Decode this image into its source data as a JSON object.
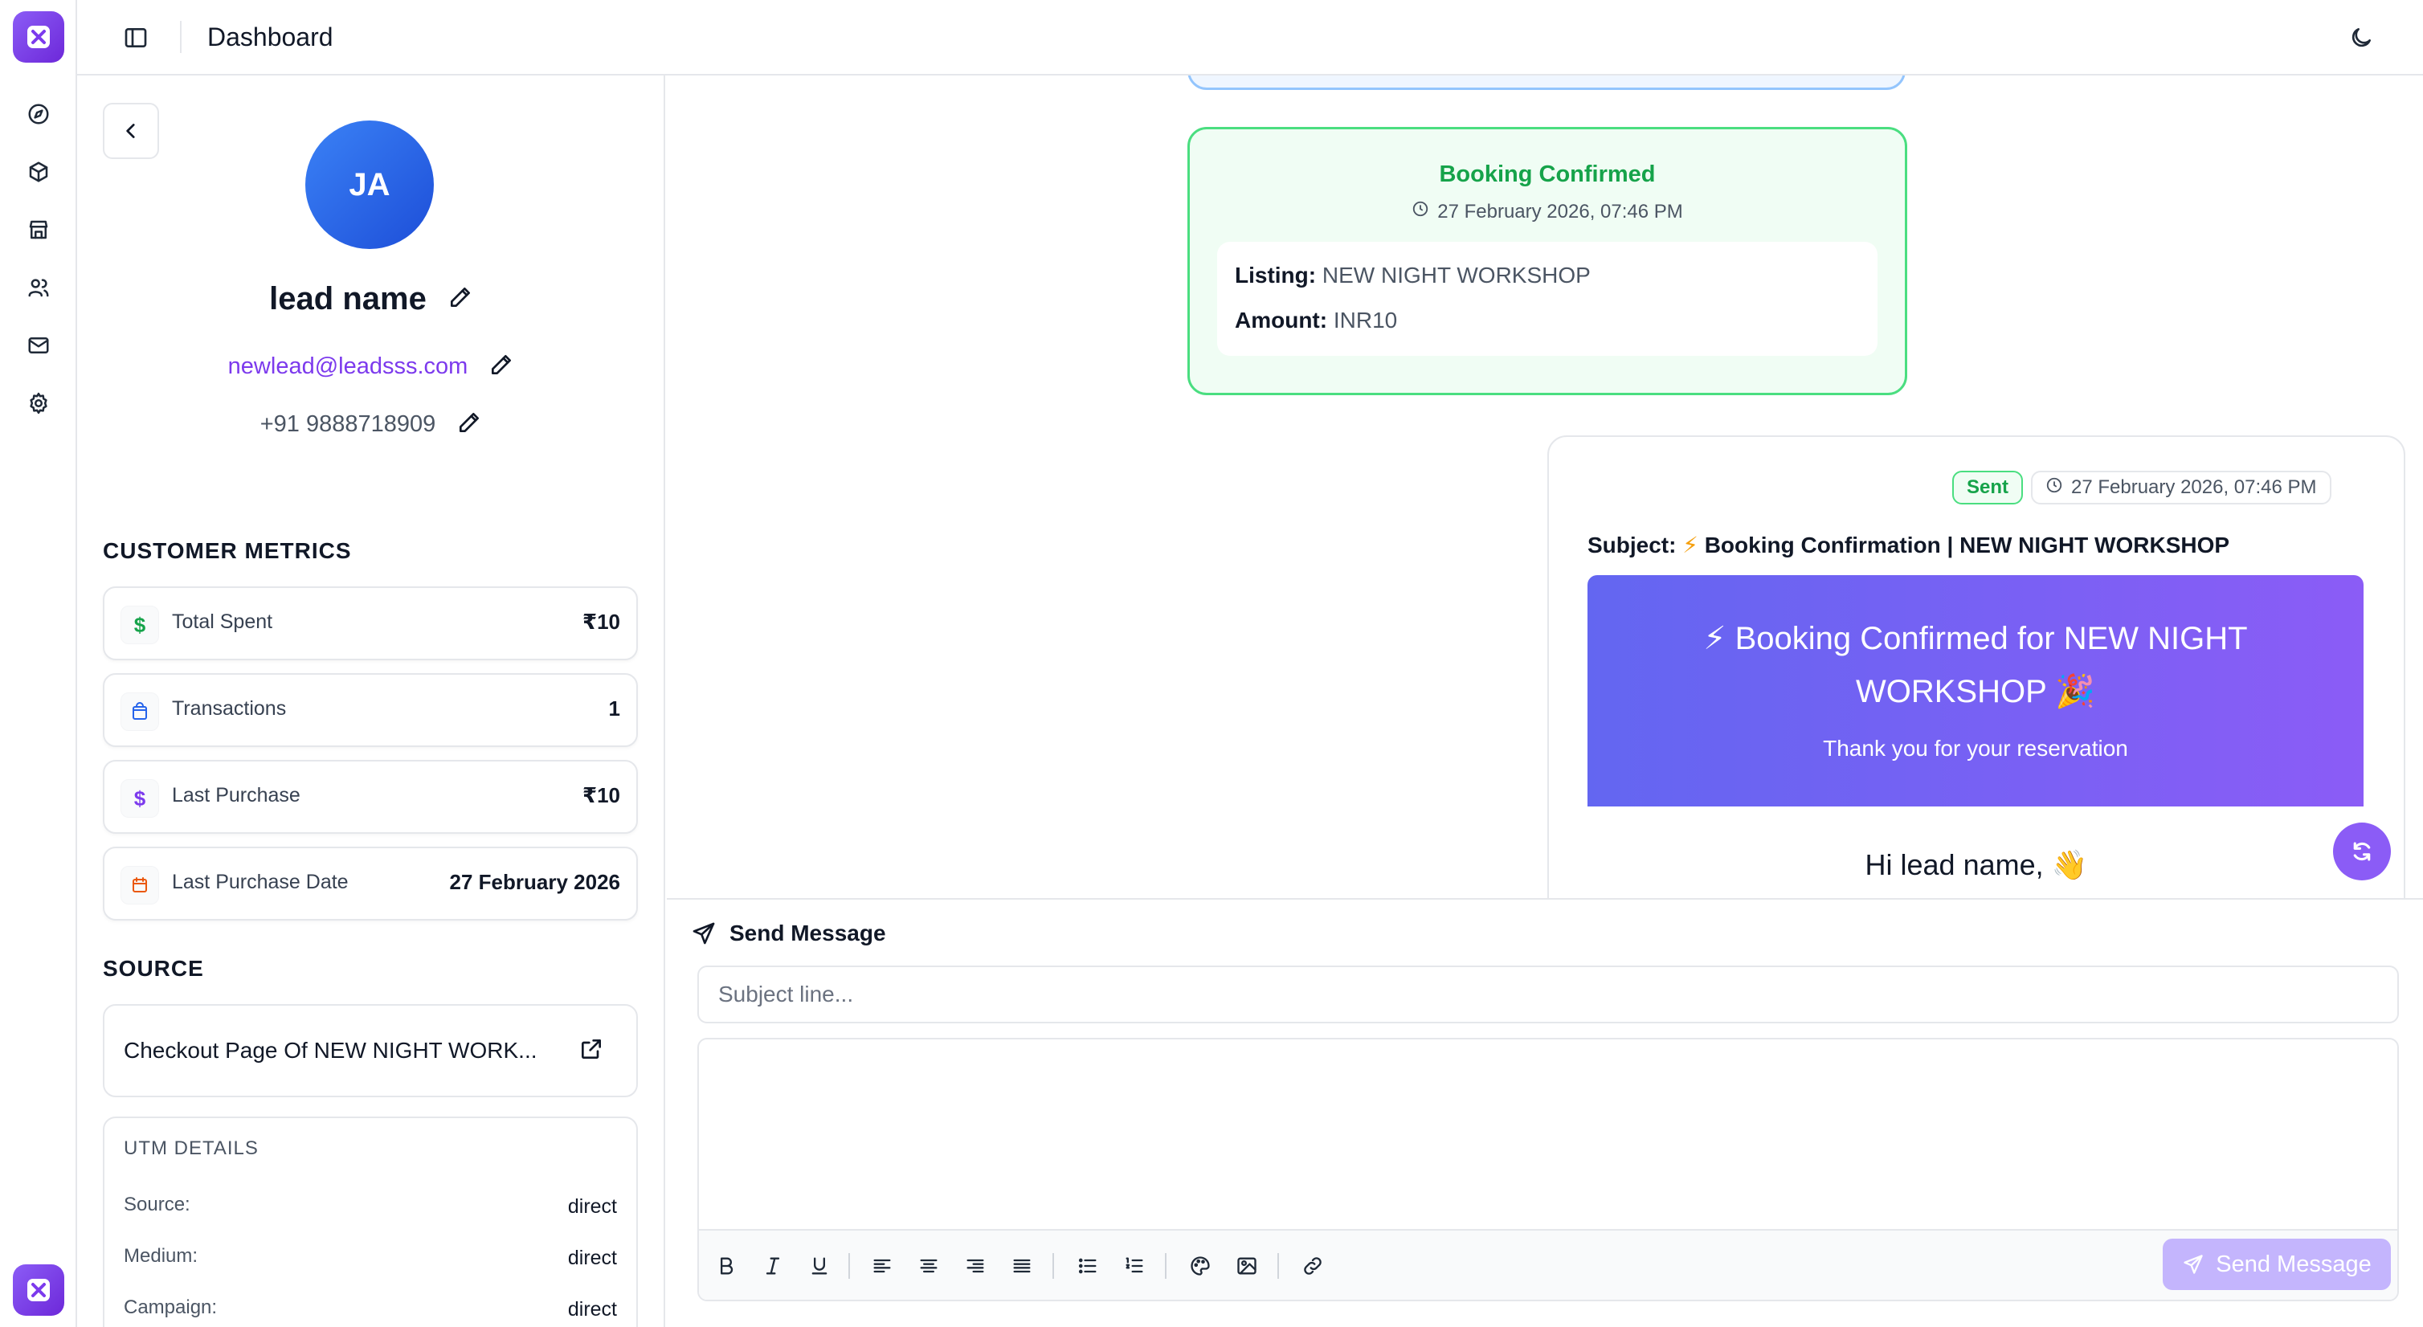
{
  "header": {
    "title": "Dashboard"
  },
  "rail": {
    "items": [
      "compass-icon",
      "package-icon",
      "store-icon",
      "users-icon",
      "mail-icon",
      "settings-icon"
    ]
  },
  "profile": {
    "initials": "JA",
    "name": "lead name",
    "email": "newlead@leadsss.com",
    "phone": "+91 9888718909"
  },
  "metrics": {
    "title": "CUSTOMER METRICS",
    "items": [
      {
        "label": "Total Spent",
        "value": "₹10",
        "icon": "dollar-icon",
        "color": "#16a34a"
      },
      {
        "label": "Transactions",
        "value": "1",
        "icon": "shopping-bag-icon",
        "color": "#2563eb"
      },
      {
        "label": "Last Purchase",
        "value": "₹10",
        "icon": "dollar-icon",
        "color": "#7c3aed"
      },
      {
        "label": "Last Purchase Date",
        "value": "27 February 2026",
        "icon": "calendar-icon",
        "color": "#ea580c"
      }
    ]
  },
  "source": {
    "title": "SOURCE",
    "label": "Checkout Page Of NEW NIGHT WORK...",
    "utm_title": "UTM DETAILS",
    "utm": [
      {
        "key": "Source:",
        "value": "direct"
      },
      {
        "key": "Medium:",
        "value": "direct"
      },
      {
        "key": "Campaign:",
        "value": "direct"
      }
    ]
  },
  "booking": {
    "title": "Booking Confirmed",
    "time": "27 February 2026, 07:46 PM",
    "listing_label": "Listing:",
    "listing": "NEW NIGHT WORKSHOP",
    "amount_label": "Amount:",
    "amount": "INR10"
  },
  "email_message": {
    "status": "Sent",
    "time": "27 February 2026, 07:46 PM",
    "subject_label": "Subject:",
    "subject_bolt": "⚡",
    "subject": "Booking Confirmation | NEW NIGHT WORKSHOP",
    "banner_title": "⚡ Booking Confirmed for NEW NIGHT WORKSHOP 🎉",
    "banner_subtitle": "Thank you for your reservation",
    "greeting": "Hi lead name, 👋"
  },
  "composer": {
    "title": "Send Message",
    "subject_placeholder": "Subject line...",
    "send_label": "Send Message"
  },
  "colors": {
    "brand": "#8b5cf6",
    "success": "#16a34a",
    "email_link": "#7c3aed"
  }
}
